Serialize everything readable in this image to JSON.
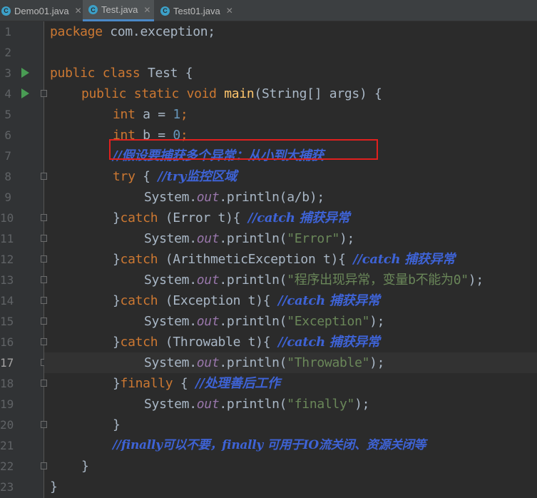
{
  "tabs": [
    {
      "label": "Demo01.java",
      "icon": "class-c-icon"
    },
    {
      "label": "Test.java",
      "icon": "class-c-icon"
    },
    {
      "label": "Test01.java",
      "icon": "class-c-icon"
    }
  ],
  "colors": {
    "keyword": "#cc7832",
    "string": "#6a8759",
    "number": "#6897bb",
    "comment": "#3e63d6",
    "method": "#ffc66d",
    "highlight_box": "#e0201e"
  },
  "lines": {
    "l1": {
      "num": "1",
      "t1": "package",
      "t2": " com.exception;"
    },
    "l2": {
      "num": "2"
    },
    "l3": {
      "num": "3",
      "t1": "public",
      "t2": " ",
      "t3": "class",
      "t4": " Test {"
    },
    "l4": {
      "num": "4",
      "t1": "public",
      "t2": " ",
      "t3": "static",
      "t4": " ",
      "t5": "void",
      "t6": " ",
      "t7": "main",
      "t8": "(String[] args) {"
    },
    "l5": {
      "num": "5",
      "t1": "int",
      "t2": " a = ",
      "t3": "1",
      "t4": ";"
    },
    "l6": {
      "num": "6",
      "t1": "int",
      "t2": " b = ",
      "t3": "0",
      "t4": ";"
    },
    "l7": {
      "num": "7",
      "t1": "//假设要捕获多个异常：从小到大捕获"
    },
    "l8": {
      "num": "8",
      "t1": "try",
      "t2": " { ",
      "t3": "//try监控区域"
    },
    "l9": {
      "num": "9",
      "t1": "System.",
      "t2": "out",
      "t3": ".println(a/b);"
    },
    "l10": {
      "num": "10",
      "t1": "}",
      "t2": "catch",
      "t3": " (Error t){ ",
      "t4": "//catch 捕获异常"
    },
    "l11": {
      "num": "11",
      "t1": "System.",
      "t2": "out",
      "t3": ".println(",
      "t4": "\"Error\"",
      "t5": ");"
    },
    "l12": {
      "num": "12",
      "t1": "}",
      "t2": "catch",
      "t3": " (ArithmeticException t){ ",
      "t4": "//catch 捕获异常"
    },
    "l13": {
      "num": "13",
      "t1": "System.",
      "t2": "out",
      "t3": ".println(",
      "t4": "\"程序出现异常，变量b不能为0\"",
      "t5": ");"
    },
    "l14": {
      "num": "14",
      "t1": "}",
      "t2": "catch",
      "t3": " (Exception t){ ",
      "t4": "//catch 捕获异常"
    },
    "l15": {
      "num": "15",
      "t1": "System.",
      "t2": "out",
      "t3": ".println(",
      "t4": "\"Exception\"",
      "t5": ");"
    },
    "l16": {
      "num": "16",
      "t1": "}",
      "t2": "catch",
      "t3": " (Throwable t){ ",
      "t4": "//catch 捕获异常"
    },
    "l17": {
      "num": "17",
      "t1": "System.",
      "t2": "out",
      "t3": ".println(",
      "t4": "\"Throwable\"",
      "t5": ");"
    },
    "l18": {
      "num": "18",
      "t1": "}",
      "t2": "finally",
      "t3": " { ",
      "t4": "//处理善后工作"
    },
    "l19": {
      "num": "19",
      "t1": "System.",
      "t2": "out",
      "t3": ".println(",
      "t4": "\"finally\"",
      "t5": ");"
    },
    "l20": {
      "num": "20",
      "t1": "}"
    },
    "l21": {
      "num": "21",
      "t1": "//finally可以不要，finally 可用于IO流关闭、资源关闭等"
    },
    "l22": {
      "num": "22",
      "t1": "}"
    },
    "l23": {
      "num": "23",
      "t1": "}"
    }
  }
}
